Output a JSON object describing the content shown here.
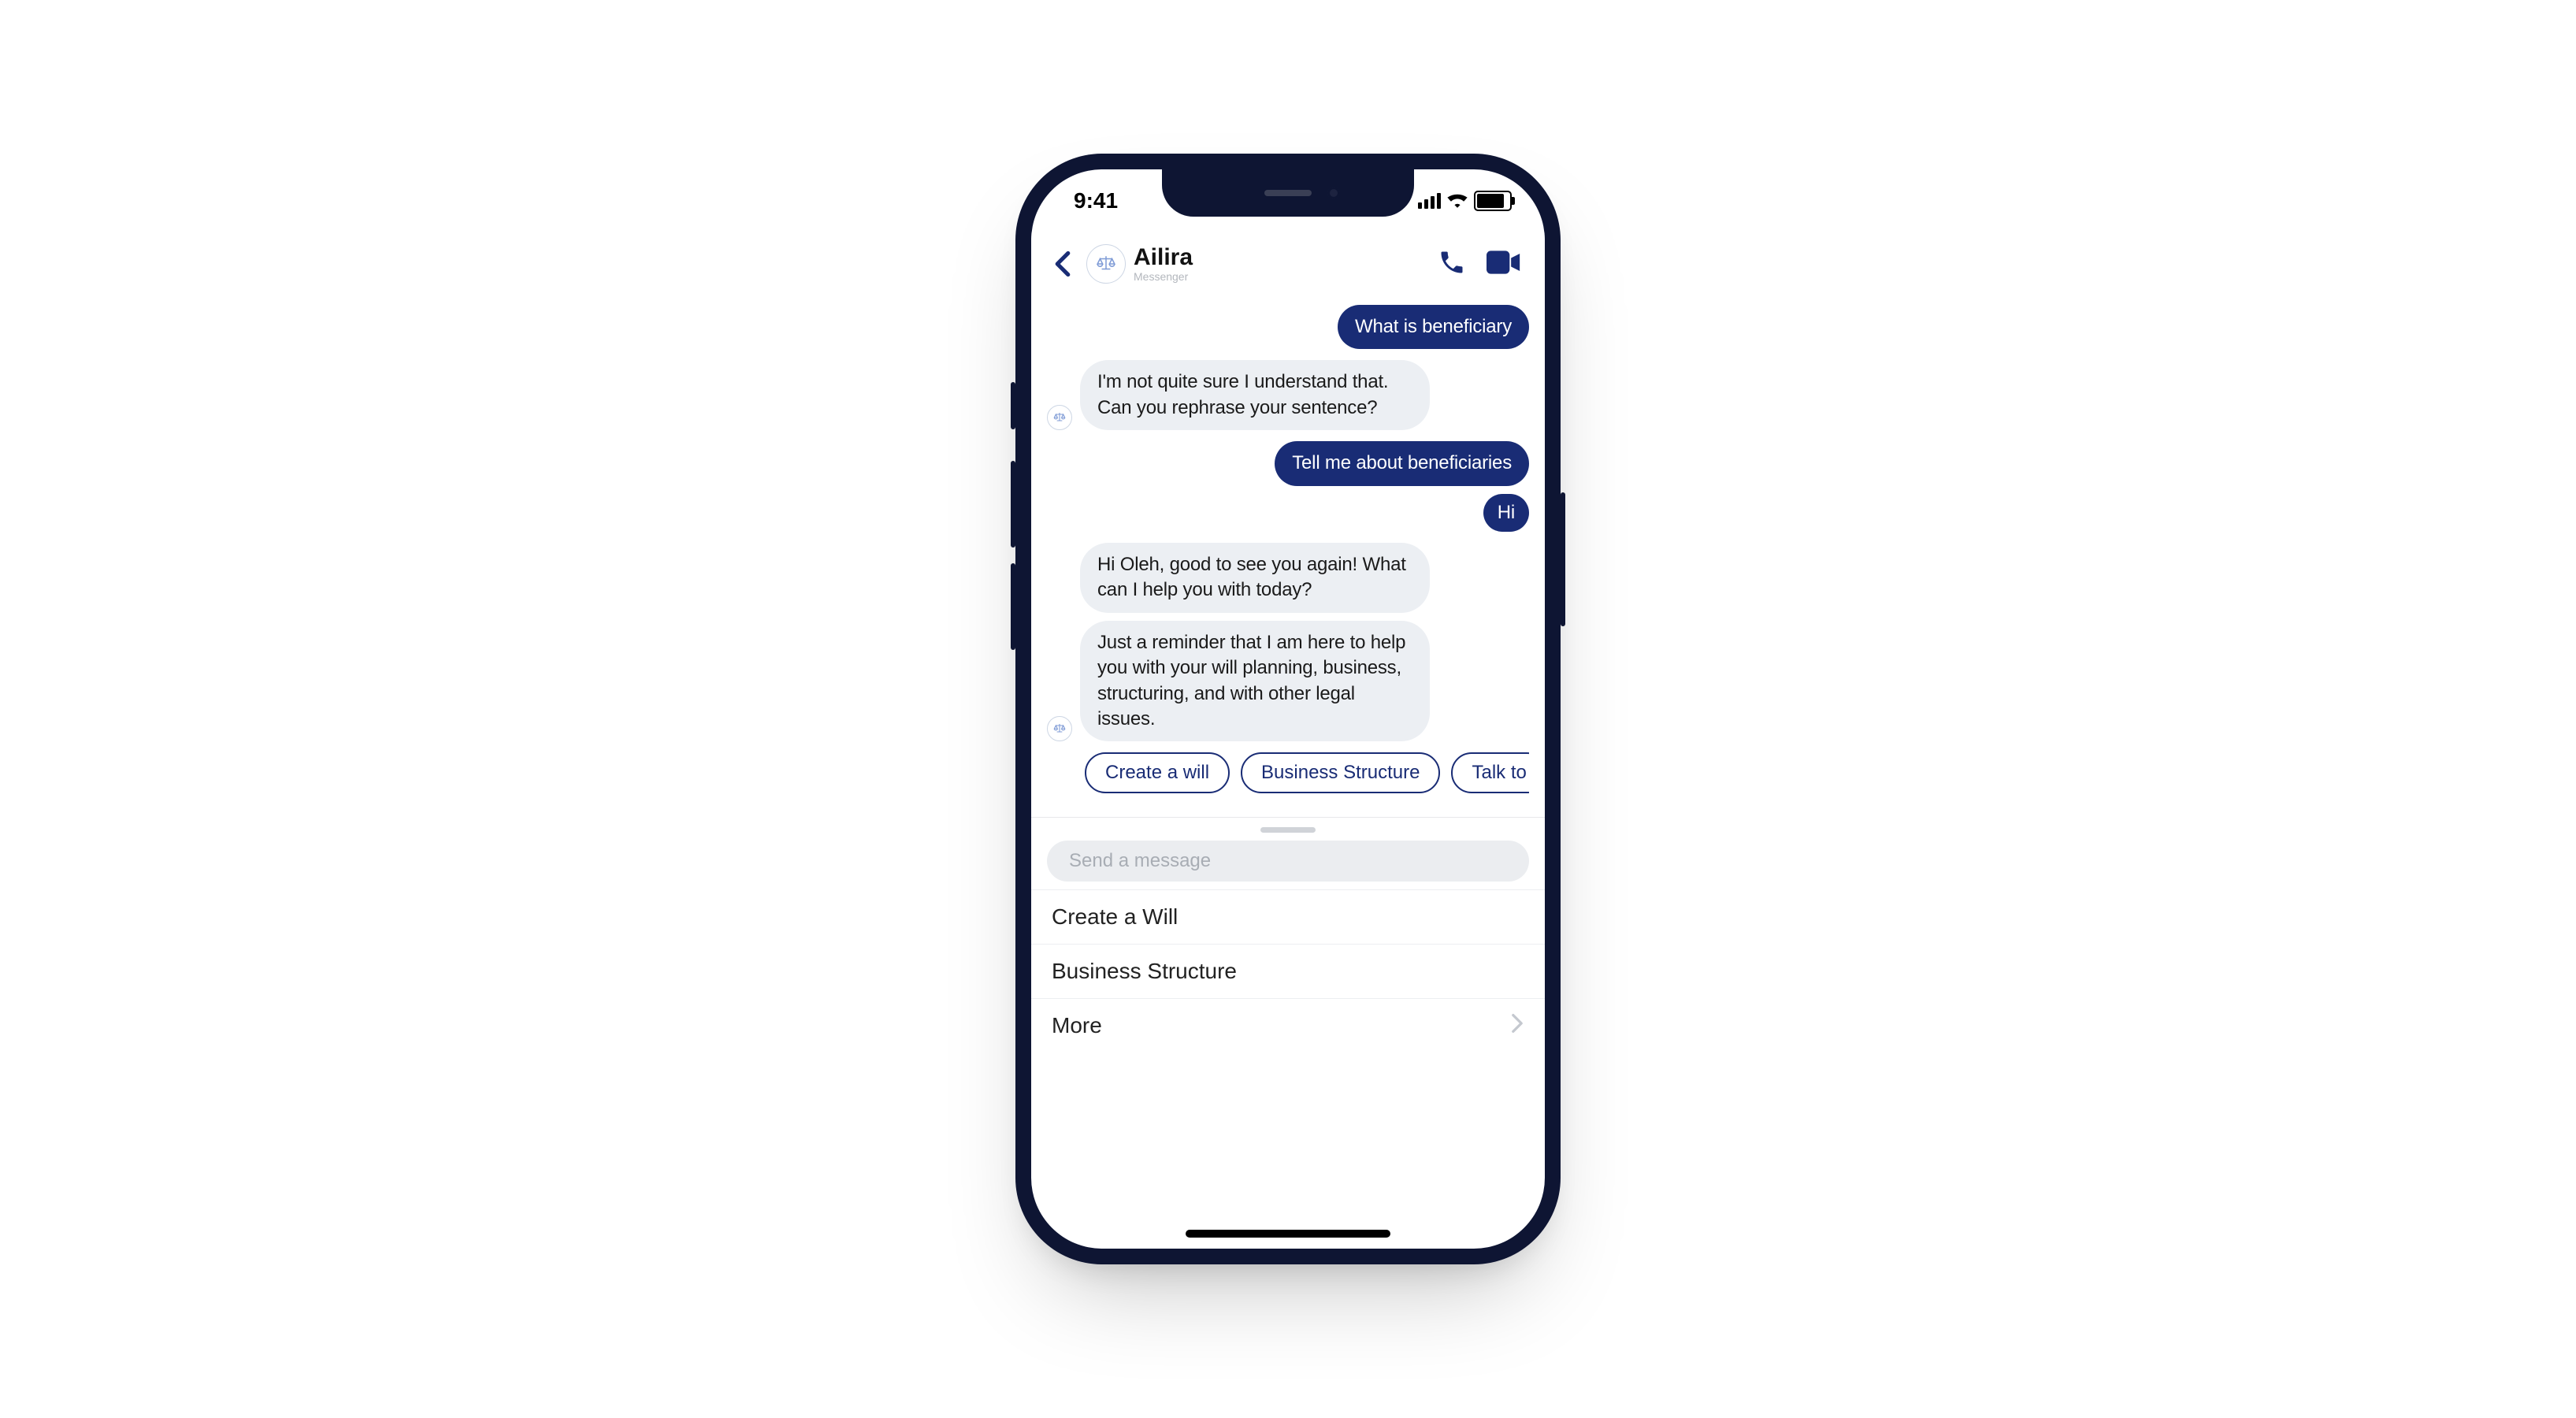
{
  "status": {
    "time": "9:41"
  },
  "header": {
    "title": "Ailira",
    "subtitle": "Messenger"
  },
  "messages": {
    "m0": "What is beneficiary",
    "m1": "I'm not quite sure I understand that. Can you rephrase your sentence?",
    "m2": "Tell me about beneficiaries",
    "m3": "Hi",
    "m4": "Hi Oleh, good to see you again! What can I help you with today?",
    "m5": "Just a reminder that I am here to help you with your will planning, business, structuring, and with other legal issues."
  },
  "chips": {
    "c0": "Create a will",
    "c1": "Business Structure",
    "c2": "Talk to"
  },
  "composer": {
    "placeholder": "Send a message"
  },
  "menu": {
    "i0": "Create a Will",
    "i1": "Business Structure",
    "i2": "More"
  }
}
